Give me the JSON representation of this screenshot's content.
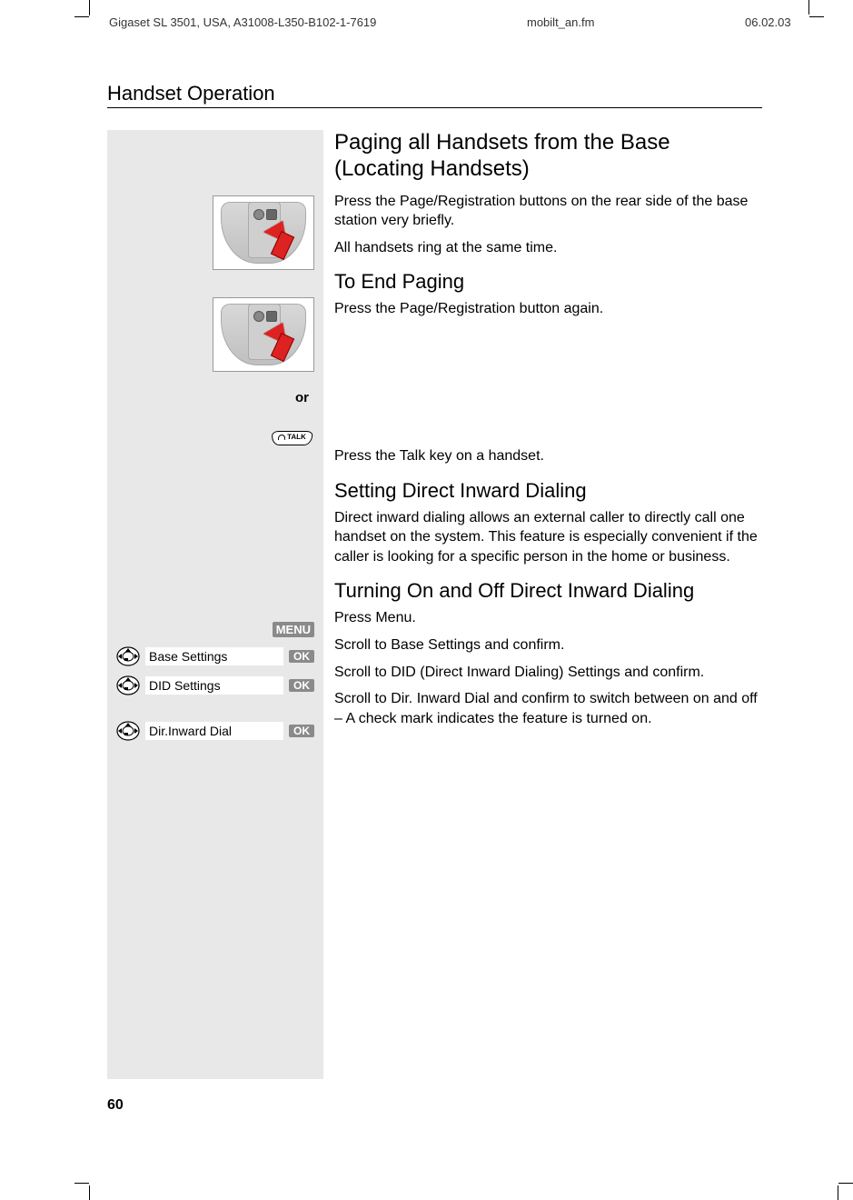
{
  "meta": {
    "doc_id": "Gigaset SL 3501, USA, A31008-L350-B102-1-7619",
    "filename": "mobilt_an.fm",
    "date": "06.02.03"
  },
  "section_title": "Handset Operation",
  "page_number": "60",
  "headings": {
    "h_paging": "Paging all Handsets from the Base (Locating Handsets)",
    "h_end_paging": "To End Paging",
    "h_did": "Setting Direct Inward Dialing",
    "h_did_toggle": "Turning On and Off Direct Inward Dialing"
  },
  "body": {
    "p_press_page": "Press the Page/Registration buttons on the rear side of the base station very briefly.",
    "p_all_ring": "All handsets ring at the same time.",
    "p_press_again": "Press the Page/Registration button again.",
    "p_press_talk": "Press the Talk key on a handset.",
    "p_did_intro": "Direct inward dialing allows an external caller to directly call one handset on the system. This feature is especially convenient if the caller is looking for a specific person in the home or business.",
    "p_menu": "Press Menu.",
    "p_base_settings": "Scroll to Base Settings and confirm.",
    "p_did_settings": "Scroll to DID (Direct Inward Dialing) Settings and confirm.",
    "p_dir_inward": "Scroll to Dir. Inward Dial and confirm to switch between on and off – A check mark indicates the feature is turned on."
  },
  "left": {
    "or_label": "or",
    "talk_label": "TALK",
    "menu_label": "MENU",
    "ok_label": "OK",
    "steps": [
      {
        "label": "Base Settings"
      },
      {
        "label": "DID Settings"
      },
      {
        "label": "Dir.Inward Dial"
      }
    ]
  }
}
